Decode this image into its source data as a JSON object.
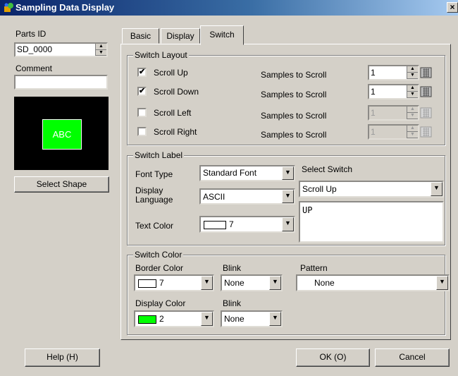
{
  "window": {
    "title": "Sampling Data Display",
    "close_label": "×"
  },
  "left": {
    "parts_id_label": "Parts ID",
    "parts_id_value": "SD_0000",
    "comment_label": "Comment",
    "comment_value": "",
    "preview_text": "ABC",
    "select_shape_label": "Select Shape"
  },
  "tabs": [
    {
      "label": "Basic"
    },
    {
      "label": "Display"
    },
    {
      "label": "Switch"
    }
  ],
  "switch_layout": {
    "title": "Switch Layout",
    "rows": [
      {
        "label": "Scroll Up",
        "checked": true,
        "samples_label": "Samples to Scroll",
        "value": "1",
        "enabled": true
      },
      {
        "label": "Scroll Down",
        "checked": true,
        "samples_label": "Samples to Scroll",
        "value": "1",
        "enabled": true
      },
      {
        "label": "Scroll Left",
        "checked": false,
        "samples_label": "Samples to Scroll",
        "value": "1",
        "enabled": false
      },
      {
        "label": "Scroll Right",
        "checked": false,
        "samples_label": "Samples to Scroll",
        "value": "1",
        "enabled": false
      }
    ]
  },
  "switch_label": {
    "title": "Switch Label",
    "font_type_label": "Font Type",
    "font_type_value": "Standard Font",
    "display_language_label": "Display\nLanguage",
    "display_language_value": "ASCII",
    "text_color_label": "Text Color",
    "text_color_value": "7",
    "select_switch_label": "Select Switch",
    "select_switch_value": "Scroll Up",
    "label_text": "UP"
  },
  "switch_color": {
    "title": "Switch Color",
    "border_color_label": "Border Color",
    "border_color_value": "7",
    "blink_label": "Blink",
    "blink1_value": "None",
    "pattern_label": "Pattern",
    "pattern_value": "None",
    "display_color_label": "Display Color",
    "display_color_value": "2",
    "blink2_label": "Blink",
    "blink2_value": "None"
  },
  "footer": {
    "help_label": "Help (H)",
    "ok_label": "OK (O)",
    "cancel_label": "Cancel"
  },
  "colors": {
    "preview_bg": "#000000",
    "preview_button": "#00ff00",
    "swatch_white": "#ffffff",
    "swatch_green": "#00ff00"
  }
}
